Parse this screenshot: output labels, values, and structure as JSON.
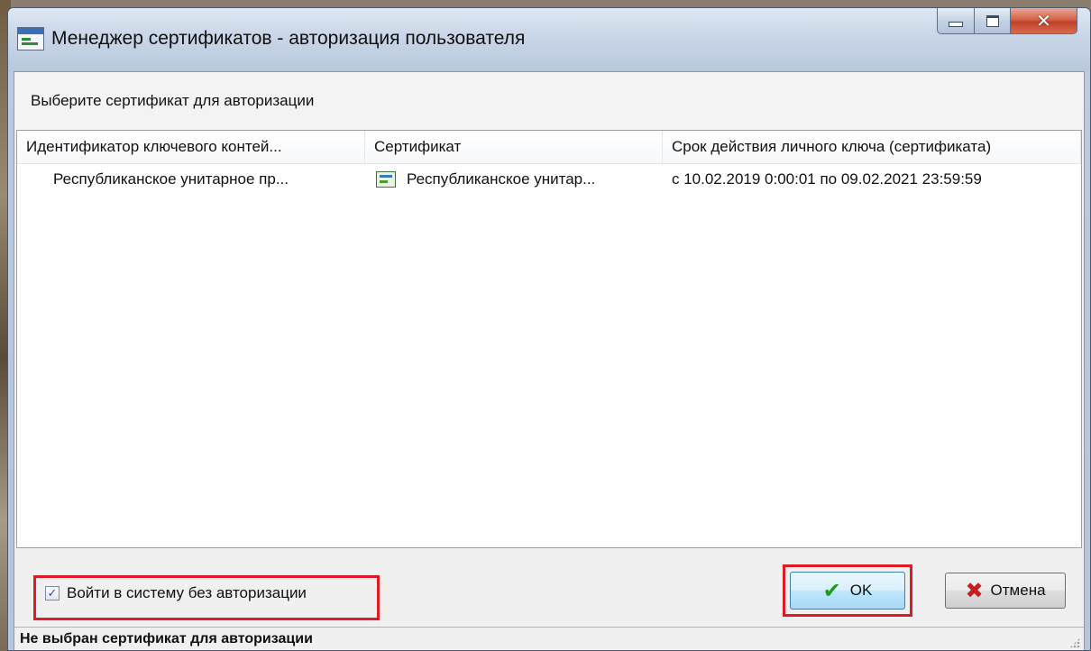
{
  "window": {
    "title": "Менеджер сертификатов - авторизация пользователя",
    "close_glyph": "✕"
  },
  "prompt": "Выберите сертификат для авторизации",
  "table": {
    "columns": [
      "Идентификатор ключевого контей...",
      "Сертификат",
      "Срок действия личного ключа (сертификата)"
    ],
    "rows": [
      {
        "container": "Республиканское унитарное пр...",
        "certificate": "Республиканское унитар...",
        "validity": "с 10.02.2019 0:00:01 по 09.02.2021 23:59:59"
      }
    ]
  },
  "checkbox": {
    "label": "Войти в систему без авторизации",
    "checked": true,
    "mark": "✓"
  },
  "buttons": {
    "ok_label": "OK",
    "ok_icon": "✔",
    "cancel_label": "Отмена",
    "cancel_icon": "✖"
  },
  "status_bar": {
    "text": "Не выбран сертификат для авторизации"
  },
  "icons": {
    "app": "certificate-manager-icon",
    "row": "certificate-icon",
    "ok": "checkmark-icon",
    "cancel": "cross-icon"
  },
  "colors": {
    "highlight": "#e01b22",
    "ok_check": "#1e9a1e",
    "cancel_cross": "#c81e1e"
  }
}
